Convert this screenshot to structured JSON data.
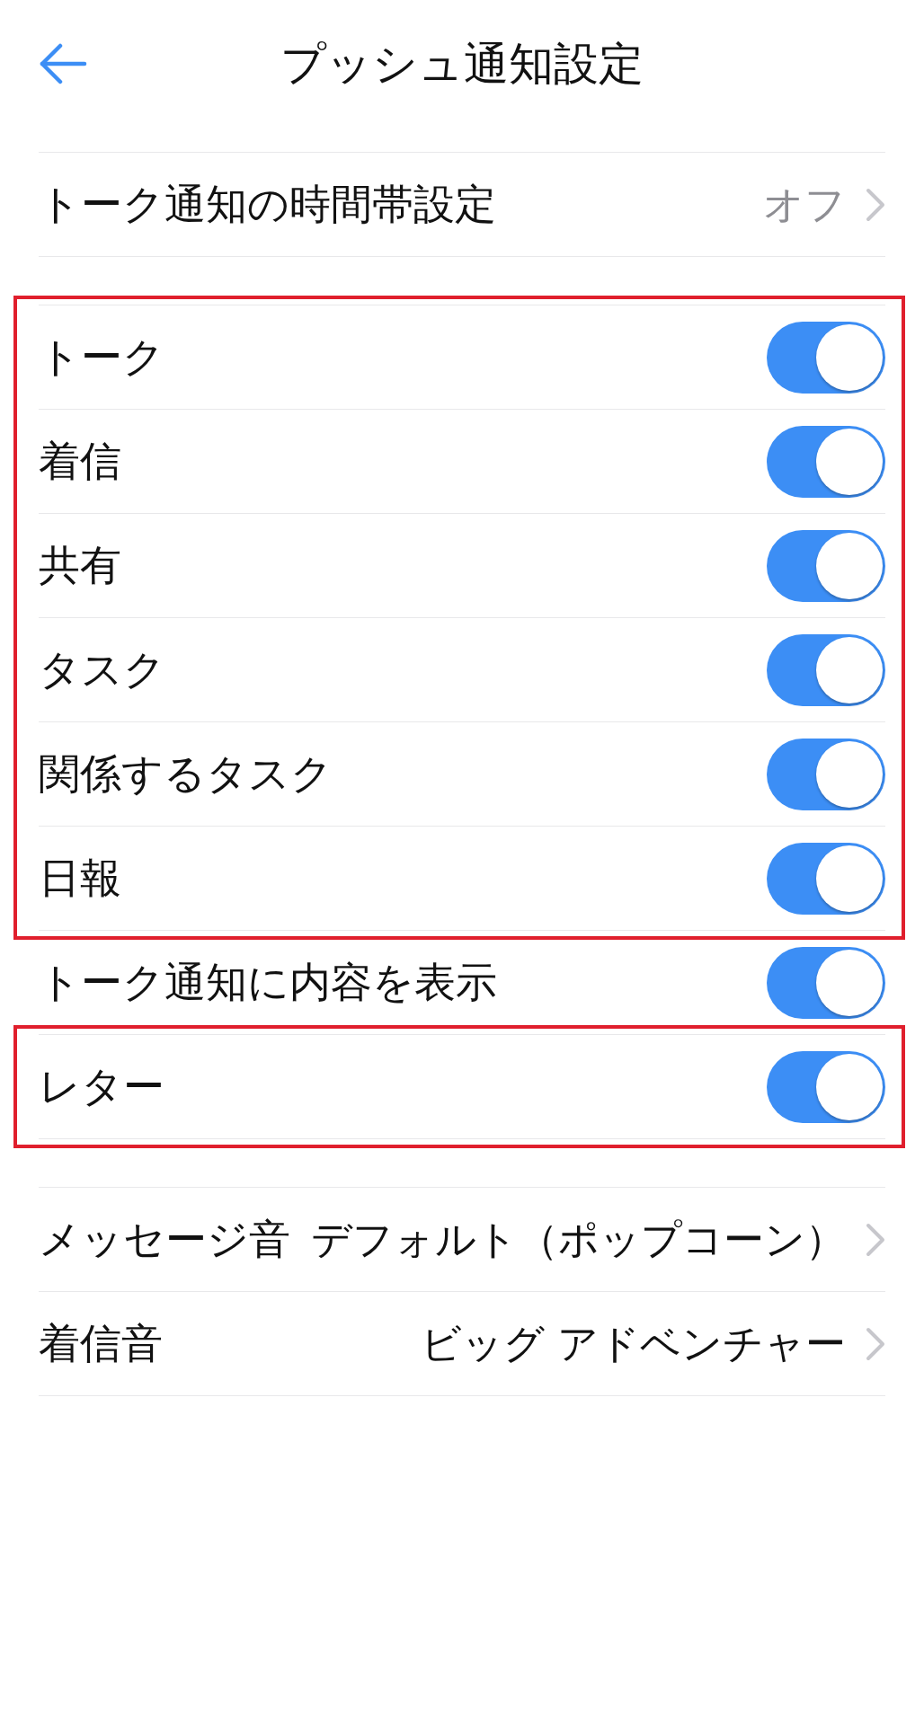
{
  "header": {
    "title": "プッシュ通知設定"
  },
  "schedule_row": {
    "label": "トーク通知の時間帯設定",
    "value": "オフ"
  },
  "toggle_groups": [
    {
      "highlighted": true,
      "rows": [
        {
          "label": "トーク",
          "on": true
        },
        {
          "label": "着信",
          "on": true
        },
        {
          "label": "共有",
          "on": true
        },
        {
          "label": "タスク",
          "on": true
        },
        {
          "label": "関係するタスク",
          "on": true
        },
        {
          "label": "日報",
          "on": true
        }
      ]
    },
    {
      "highlighted": false,
      "rows": [
        {
          "label": "トーク通知に内容を表示",
          "on": true
        }
      ]
    },
    {
      "highlighted": true,
      "rows": [
        {
          "label": "レター",
          "on": true
        }
      ]
    }
  ],
  "sound_rows": [
    {
      "label": "メッセージ音",
      "value": "デフォルト（ポップコーン）"
    },
    {
      "label": "着信音",
      "value": "ビッグ アドベンチャー"
    }
  ]
}
